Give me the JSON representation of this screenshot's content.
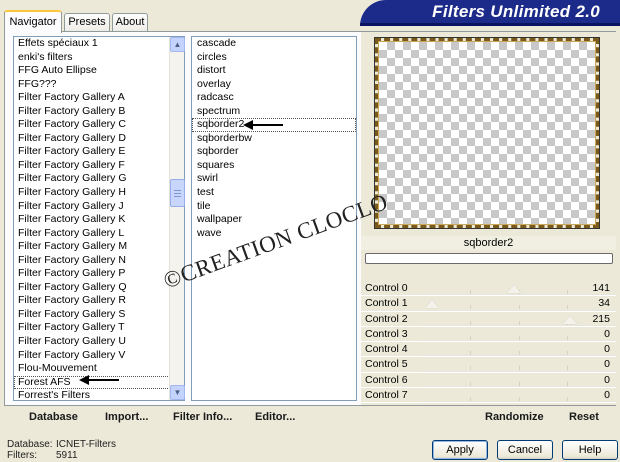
{
  "tabs": [
    {
      "label": "Navigator",
      "active": true
    },
    {
      "label": "Presets",
      "active": false
    },
    {
      "label": "About",
      "active": false
    }
  ],
  "banner": {
    "title": "Filters Unlimited 2.0",
    "color": "#1c2a8a"
  },
  "categories": [
    "Effets spéciaux 1",
    "enki's filters",
    "FFG Auto Ellipse",
    "FFG???",
    "Filter Factory Gallery A",
    "Filter Factory Gallery B",
    "Filter Factory Gallery C",
    "Filter Factory Gallery D",
    "Filter Factory Gallery E",
    "Filter Factory Gallery F",
    "Filter Factory Gallery G",
    "Filter Factory Gallery H",
    "Filter Factory Gallery J",
    "Filter Factory Gallery K",
    "Filter Factory Gallery L",
    "Filter Factory Gallery M",
    "Filter Factory Gallery N",
    "Filter Factory Gallery P",
    "Filter Factory Gallery Q",
    "Filter Factory Gallery R",
    "Filter Factory Gallery S",
    "Filter Factory Gallery T",
    "Filter Factory Gallery U",
    "Filter Factory Gallery V",
    "Flou-Mouvement",
    "Forest AFS",
    "Forrest's Filters"
  ],
  "selected_category": "Forest AFS",
  "filters": [
    "cascade",
    "circles",
    "distort",
    "overlay",
    "radcasc",
    "spectrum",
    "sqborder2",
    "sqborderbw",
    "sqborder",
    "squares",
    "swirl",
    "test",
    "tile",
    "wallpaper",
    "wave"
  ],
  "selected_filter": "sqborder2",
  "preview": {
    "filter_name": "sqborder2"
  },
  "controls": [
    {
      "label": "Control 0",
      "value": "141",
      "level": 141
    },
    {
      "label": "Control 1",
      "value": "34",
      "level": 34
    },
    {
      "label": "Control 2",
      "value": "215",
      "level": 215
    },
    {
      "label": "Control 3",
      "value": "0",
      "level": 0
    },
    {
      "label": "Control 4",
      "value": "0",
      "level": 0
    },
    {
      "label": "Control 5",
      "value": "0",
      "level": 0
    },
    {
      "label": "Control 6",
      "value": "0",
      "level": 0
    },
    {
      "label": "Control 7",
      "value": "0",
      "level": 0
    }
  ],
  "toolbar": {
    "database": "Database",
    "import": "Import...",
    "filter_info": "Filter Info...",
    "editor": "Editor...",
    "randomize": "Randomize",
    "reset": "Reset"
  },
  "footer": {
    "database_label": "Database:",
    "database_value": "ICNET-Filters",
    "filters_label": "Filters:",
    "filters_value": "5911"
  },
  "buttons": {
    "apply": "Apply",
    "cancel": "Cancel",
    "help": "Help"
  },
  "watermark": "©CREATION CLOCLO"
}
